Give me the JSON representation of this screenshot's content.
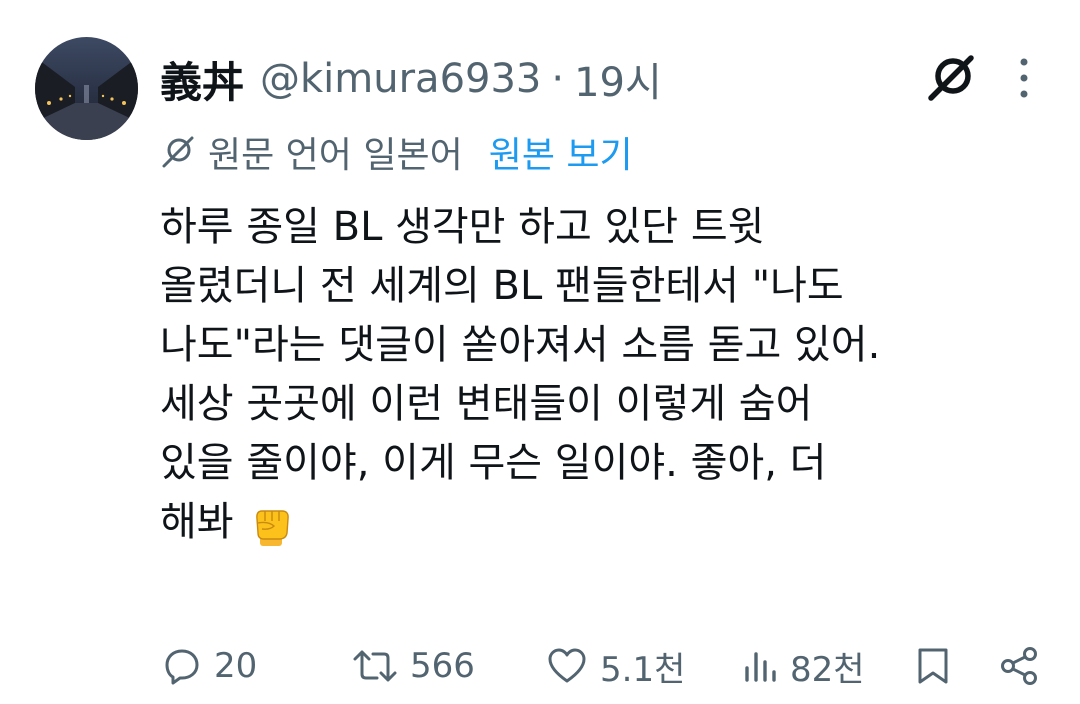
{
  "tweet": {
    "author": {
      "display_name": "義丼",
      "handle": "@kimura6933",
      "separator": "·",
      "time": "19시",
      "avatar_icon": "night-street-photo"
    },
    "translation": {
      "icon": "translate-icon",
      "source_language_text": "원문 언어 일본어",
      "show_original_label": "원본 보기",
      "link_color": "#1d9bf0"
    },
    "body_lines": [
      "하루 종일 BL 생각만 하고 있단 트윗",
      "올렸더니 전 세계의 BL 팬들한테서 \"나도",
      "나도\"라는 댓글이 쏟아져서 소름 돋고 있어.",
      "세상 곳곳에 이런 변태들이 이렇게 숨어",
      "있을 줄이야, 이게 무슨 일이야. 좋아, 더",
      "해봐"
    ],
    "body_emoji": "raised-fist-emoji",
    "actions": {
      "reply": {
        "icon": "reply-icon",
        "count": "20"
      },
      "retweet": {
        "icon": "retweet-icon",
        "count": "566"
      },
      "like": {
        "icon": "heart-icon",
        "count": "5.1천"
      },
      "views": {
        "icon": "views-chart-icon",
        "count": "82천"
      },
      "bookmark": {
        "icon": "bookmark-icon"
      },
      "share": {
        "icon": "share-icon"
      }
    },
    "toolbar": {
      "grok_icon": "grok-icon",
      "more_icon": "more-vertical-icon"
    }
  },
  "colors": {
    "text_primary": "#0f1419",
    "text_secondary": "#536471",
    "accent": "#1d9bf0"
  }
}
